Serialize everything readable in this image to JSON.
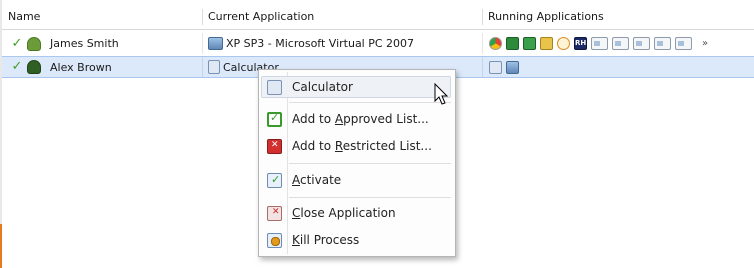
{
  "columns": {
    "name": "Name",
    "current_application": "Current Application",
    "running_applications": "Running Applications"
  },
  "rows": [
    {
      "name": "James Smith",
      "current_app": "XP SP3 - Microsoft Virtual PC 2007",
      "current_app_icon": "virtual-pc-icon",
      "running_icons": [
        "chrome-icon",
        "excel-icon",
        "excel-icon",
        "tool-icon",
        "clock-icon",
        "rh-icon",
        "window-icon",
        "window-icon",
        "window-icon",
        "window-icon",
        "window-icon"
      ],
      "more": "»"
    },
    {
      "name": "Alex Brown",
      "current_app": "Calculator",
      "current_app_icon": "calculator-icon",
      "running_icons": [
        "calculator-icon",
        "window-icon"
      ],
      "selected": true
    }
  ],
  "context_menu": {
    "items": [
      {
        "id": "calculator",
        "text": "Calculator",
        "icon": "calculator-icon"
      },
      {
        "id": "approve",
        "pre": "Add to ",
        "acc": "A",
        "post": "pproved List...",
        "icon": "approve-shield-icon"
      },
      {
        "id": "restrict",
        "pre": "Add to ",
        "acc": "R",
        "post": "estricted List...",
        "icon": "restrict-shield-icon"
      },
      {
        "id": "activate",
        "pre": "",
        "acc": "A",
        "post": "ctivate",
        "icon": "activate-icon"
      },
      {
        "id": "close",
        "pre": "",
        "acc": "C",
        "post": "lose Application",
        "icon": "close-app-icon"
      },
      {
        "id": "kill",
        "pre": "",
        "acc": "K",
        "post": "ill Process",
        "icon": "kill-process-icon"
      }
    ]
  },
  "colors": {
    "selection": "#dce9fb",
    "accent_orange": "#e87a1e",
    "approve_green": "#3a9a2c",
    "restrict_red": "#d32f2f"
  }
}
